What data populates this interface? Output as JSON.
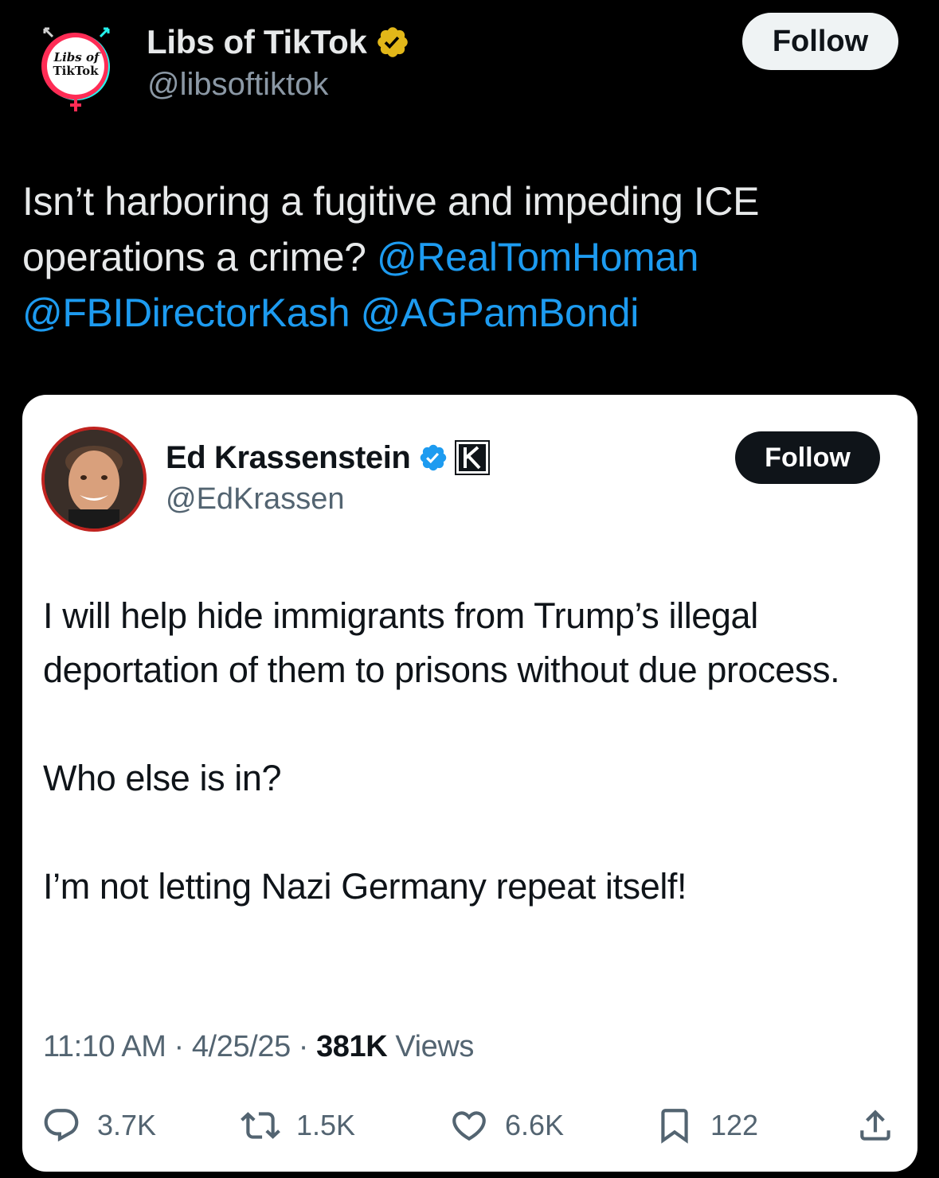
{
  "outer_post": {
    "avatar_text_line1": "Libs of",
    "avatar_text_line2": "TikTok",
    "display_name": "Libs of TikTok",
    "handle": "@libsoftiktok",
    "verified_badge": "gold-verified-badge-icon",
    "follow_label": "Follow",
    "text_plain": "Isn’t harboring a fugitive and impeding ICE operations a crime?",
    "mentions": [
      "@RealTomHoman",
      "@FBIDirectorKash",
      "@AGPamBondi"
    ]
  },
  "quoted_post": {
    "display_name": "Ed Krassenstein",
    "handle": "@EdKrassen",
    "verified_badge": "blue-verified-badge-icon",
    "affiliate_badge": "k-affiliate-badge-icon",
    "follow_label": "Follow",
    "paragraphs": [
      "I will help hide immigrants from Trump’s illegal deportation of them to prisons without due process.",
      "Who else is in?",
      "I’m not letting Nazi Germany repeat itself!"
    ],
    "time": "11:10 AM",
    "separator": "·",
    "date": "4/25/25",
    "views_count": "381K",
    "views_label": "Views",
    "actions": {
      "replies": "3.7K",
      "reposts": "1.5K",
      "likes": "6.6K",
      "bookmarks": "122"
    }
  },
  "colors": {
    "background": "#000000",
    "card_background": "#ffffff",
    "mention": "#1d9bf0",
    "outer_text": "#e7e9ea",
    "outer_muted": "#8b98a5",
    "card_muted": "#536471",
    "gold_badge": "#e2b719",
    "blue_badge": "#1d9bf0"
  }
}
